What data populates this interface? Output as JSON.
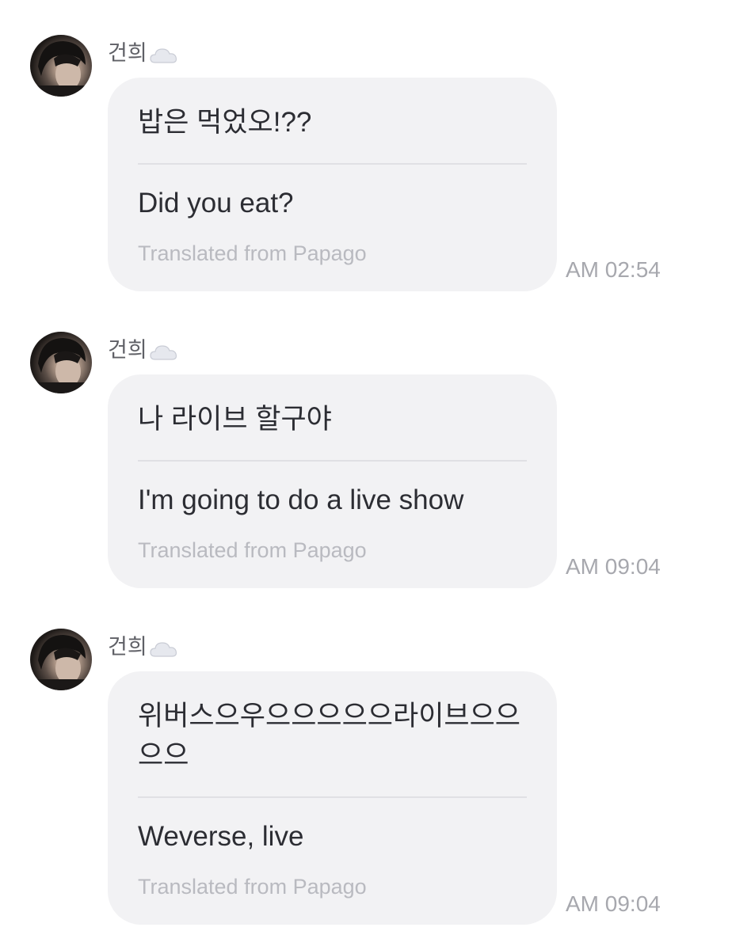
{
  "messages": [
    {
      "sender": "건희",
      "original": "밥은 먹었오!??",
      "translation": "Did you eat?",
      "translated_from": "Translated from Papago",
      "time": "AM 02:54"
    },
    {
      "sender": "건희",
      "original": "나 라이브 할구야",
      "translation": "I'm going to do a live show",
      "translated_from": "Translated from Papago",
      "time": "AM 09:04"
    },
    {
      "sender": "건희",
      "original": "위버스으우으으으으으라이브으으으으",
      "translation": "Weverse, live",
      "translated_from": "Translated from Papago",
      "time": "AM 09:04"
    }
  ],
  "icons": {
    "sender_emoji": "cloud-icon"
  },
  "colors": {
    "bubble_background": "#f2f2f4",
    "primary_text": "#2c2d33",
    "muted_text": "#b9bac0",
    "timestamp_text": "#a7a8ae"
  }
}
